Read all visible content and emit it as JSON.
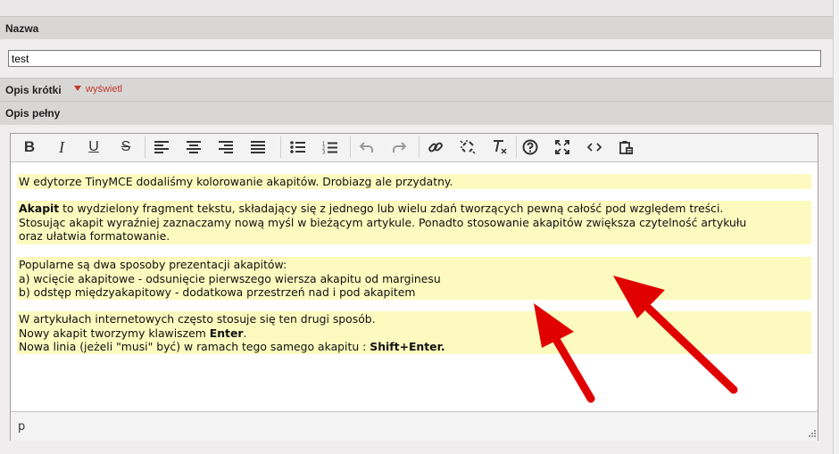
{
  "fields": {
    "name_label": "Nazwa",
    "name_value": "test",
    "short_label": "Opis krótki",
    "short_toggle": "wyświetl",
    "full_label": "Opis pełny"
  },
  "toolbar": {
    "bold": "B",
    "italic": "I",
    "underline": "U",
    "strike": "S"
  },
  "content": {
    "p1": "W edytorze TinyMCE dodaliśmy kolorowanie akapitów. Drobiazg ale przydatny.",
    "p2_bold": "Akapit",
    "p2_l1": " to wydzielony fragment tekstu, składający się z jednego lub wielu zdań tworzących pewną całość pod względem treści.",
    "p2_l2": "Stosując akapit wyraźniej zaznaczamy nową myśl w bieżącym artykule. Ponadto stosowanie akapitów zwiększa czytelność artykułu",
    "p2_l3": "oraz ułatwia formatowanie.",
    "p3_l1": "Popularne są dwa sposoby prezentacji akapitów:",
    "p3_l2": "a) wcięcie akapitowe - odsunięcie pierwszego wiersza akapitu od marginesu",
    "p3_l3": "b) odstęp międzyakapitowy - dodatkowa przestrzeń nad i pod akapitem",
    "p4_l1": "W artykułach internetowych często stosuje się ten drugi sposób.",
    "p4_l2a": "Nowy akapit tworzymy klawiszem ",
    "p4_l2b": "Enter",
    "p4_l2c": ".",
    "p4_l3a": "Nowa linia (jeżeli \"musi\" być) w ramach tego samego akapitu : ",
    "p4_l3b": "Shift+Enter."
  },
  "status": {
    "path": "p"
  },
  "colors": {
    "highlight": "#fcfabf",
    "arrow": "#e00000",
    "link": "#c0392b"
  }
}
